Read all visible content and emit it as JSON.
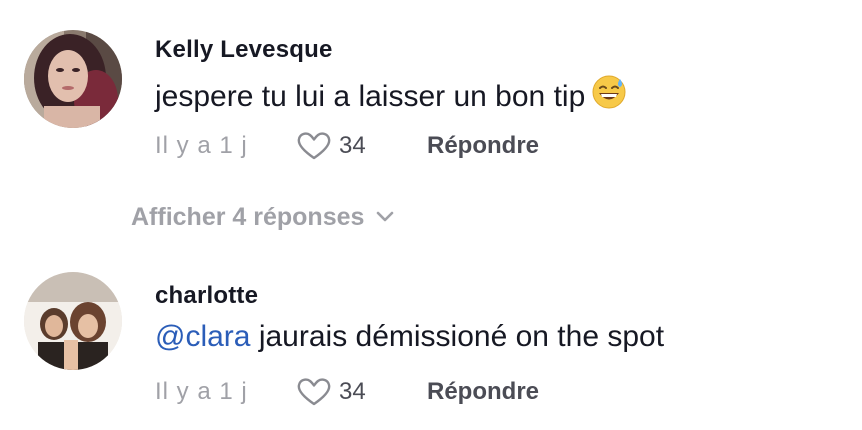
{
  "comments": [
    {
      "username": "Kelly Levesque",
      "text": "jespere tu lui a laisser un bon tip",
      "emoji": "grinning-face-with-sweat",
      "timestamp": "Il y a 1 j",
      "likes": "34",
      "reply_label": "Répondre"
    },
    {
      "username": "charlotte",
      "mention": "@clara",
      "text": " jaurais démissioné on the spot",
      "timestamp": "Il y a 1 j",
      "likes": "34",
      "reply_label": "Répondre"
    }
  ],
  "view_replies": {
    "label": "Afficher 4 réponses"
  },
  "colors": {
    "username": "#161823",
    "secondary": "#a0a1a7",
    "mention": "#2b5db8",
    "action": "#4b4c55"
  }
}
